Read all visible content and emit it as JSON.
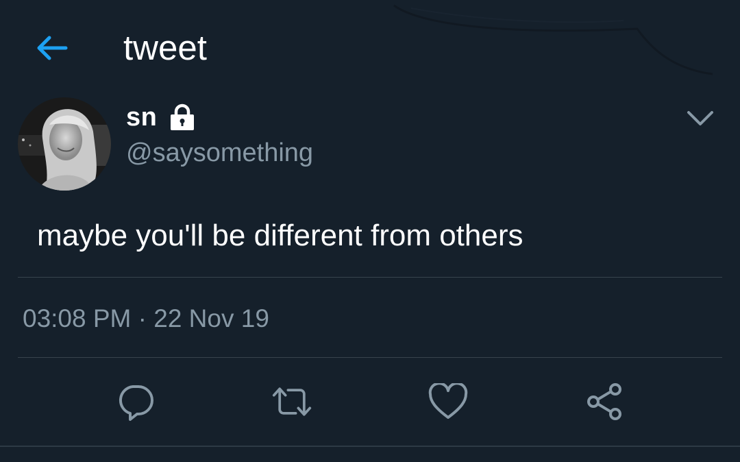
{
  "header": {
    "title": "tweet",
    "back_icon": "arrow-left-icon"
  },
  "tweet": {
    "display_name": "sn",
    "protected_icon": "lock-icon",
    "handle": "@saysomething",
    "text": "maybe you'll be different from others",
    "timestamp": "03:08 PM · 22 Nov 19",
    "menu_icon": "chevron-down-icon"
  },
  "actions": [
    {
      "icon": "reply-icon"
    },
    {
      "icon": "retweet-icon"
    },
    {
      "icon": "like-icon"
    },
    {
      "icon": "share-icon"
    }
  ],
  "colors": {
    "background": "#15202b",
    "accent": "#1da1f2",
    "muted_text": "#8899a6",
    "divider": "#38444d"
  }
}
